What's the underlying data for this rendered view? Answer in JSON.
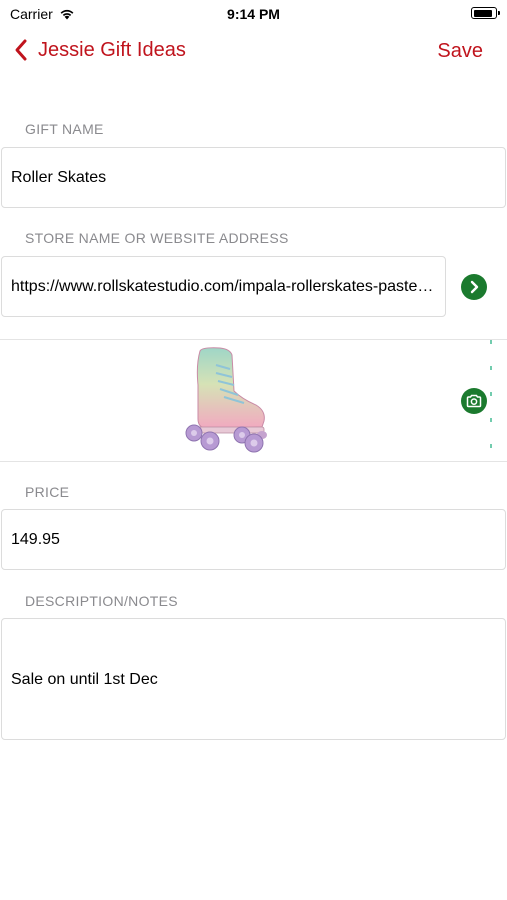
{
  "status_bar": {
    "carrier": "Carrier",
    "time": "9:14 PM",
    "battery_level": 0.9
  },
  "nav": {
    "back_title": "Jessie Gift Ideas",
    "save_label": "Save"
  },
  "form": {
    "gift_name": {
      "header": "GIFT NAME",
      "value": "Roller Skates"
    },
    "store": {
      "header": "STORE NAME OR WEBSITE ADDRESS",
      "value": "https://www.rollskatestudio.com/impala-rollerskates-pastel-fade"
    },
    "price": {
      "header": "PRICE",
      "value": "149.95"
    },
    "notes": {
      "header": "DESCRIPTION/NOTES",
      "value": "Sale on until 1st Dec"
    }
  },
  "icons": {
    "back": "chevron-left-icon",
    "go": "chevron-right-icon",
    "camera": "camera-icon",
    "wifi": "wifi-icon",
    "battery": "battery-icon"
  },
  "colors": {
    "accent": "#c0141d",
    "action_green": "#1b7a2e",
    "header_gray": "#8a8a8e"
  }
}
